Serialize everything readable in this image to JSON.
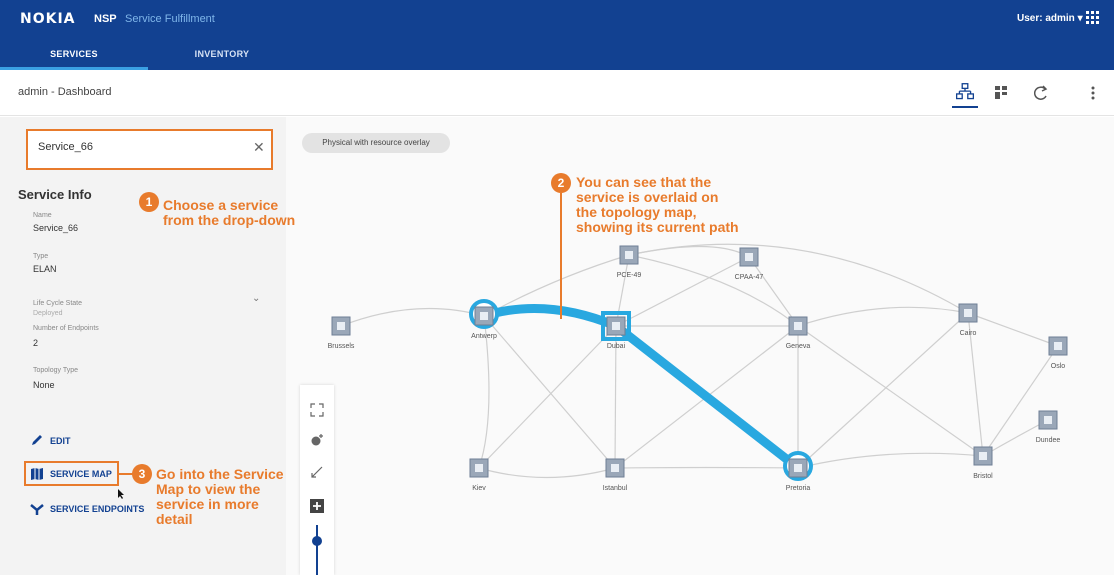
{
  "app": {
    "brand": "NOKIA",
    "product": "NSP",
    "module": "Service Fulfillment",
    "user_menu": "User: admin"
  },
  "nav": {
    "tabs": [
      {
        "label": "SERVICES",
        "active": true
      },
      {
        "label": "INVENTORY",
        "active": false
      }
    ]
  },
  "header": {
    "breadcrumb": "admin - Dashboard"
  },
  "search": {
    "value": "Service_66",
    "clear_icon": "close-icon"
  },
  "service_info": {
    "title": "Service Info",
    "name_label": "Name",
    "name_value": "Service_66",
    "type_label": "Type",
    "type_value": "ELAN",
    "lifecycle_label": "Life Cycle State",
    "lifecycle_value": "Deployed",
    "endpoints_label": "Number of Endpoints",
    "endpoints_value": "2",
    "topology_label": "Topology Type",
    "topology_value": "None"
  },
  "actions": {
    "edit": "EDIT",
    "service_map": "SERVICE MAP",
    "service_endpoints": "SERVICE ENDPOINTS"
  },
  "map": {
    "overlay_label": "Physical with resource overlay",
    "highlight_color": "#29a8e0",
    "nodes": [
      {
        "id": "brussels",
        "label": "Brussels"
      },
      {
        "id": "antwerp",
        "label": "Antwerp"
      },
      {
        "id": "dubai",
        "label": "Dubai"
      },
      {
        "id": "pce49",
        "label": "PCE-49"
      },
      {
        "id": "cpaa47",
        "label": "CPAA-47"
      },
      {
        "id": "geneva",
        "label": "Geneva"
      },
      {
        "id": "cairo",
        "label": "Cairo"
      },
      {
        "id": "oslo",
        "label": "Oslo"
      },
      {
        "id": "dundee",
        "label": "Dundee"
      },
      {
        "id": "bristol",
        "label": "Bristol"
      },
      {
        "id": "pretoria",
        "label": "Pretoria"
      },
      {
        "id": "istanbul",
        "label": "Istanbul"
      },
      {
        "id": "kiev",
        "label": "Kiev"
      }
    ]
  },
  "callouts": {
    "accent_color": "#e87b2c",
    "c1": {
      "number": "1",
      "line1": "Choose a service",
      "line2": "from the drop-down"
    },
    "c2": {
      "number": "2",
      "line1": "You can see that the",
      "line2": "service is overlaid on",
      "line3": "the topology map,",
      "line4": "showing its current path"
    },
    "c3": {
      "number": "3",
      "line1": "Go into the Service",
      "line2": "Map to view the",
      "line3": "service in more",
      "line4": "detail"
    }
  }
}
